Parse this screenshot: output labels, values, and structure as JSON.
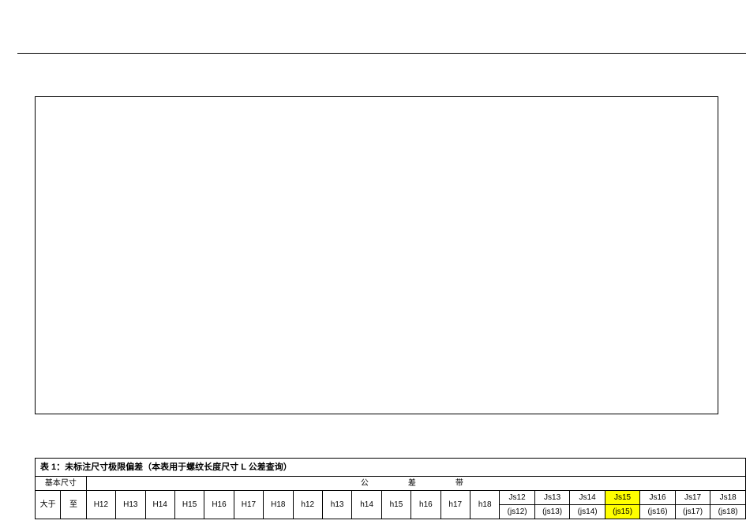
{
  "table": {
    "title": "表 1：未标注尺寸极限偏差（本表用于螺纹长度尺寸 L 公差查询）",
    "basic_size_label": "基本尺寸",
    "tol_band_label": "公　　差　　带",
    "from_label": "大于",
    "to_label": "至",
    "H": [
      "H12",
      "H13",
      "H14",
      "H15",
      "H16",
      "H17",
      "H18"
    ],
    "h": [
      "h12",
      "h13",
      "h14",
      "h15",
      "h16",
      "h17",
      "h18"
    ],
    "Js": [
      {
        "top": "Js12",
        "bot": "(js12)",
        "hl": false
      },
      {
        "top": "Js13",
        "bot": "(js13)",
        "hl": false
      },
      {
        "top": "Js14",
        "bot": "(js14)",
        "hl": false
      },
      {
        "top": "Js15",
        "bot": "(js15)",
        "hl": true
      },
      {
        "top": "Js16",
        "bot": "(js16)",
        "hl": false
      },
      {
        "top": "Js17",
        "bot": "(js17)",
        "hl": false
      },
      {
        "top": "Js18",
        "bot": "(js18)",
        "hl": false
      }
    ]
  }
}
